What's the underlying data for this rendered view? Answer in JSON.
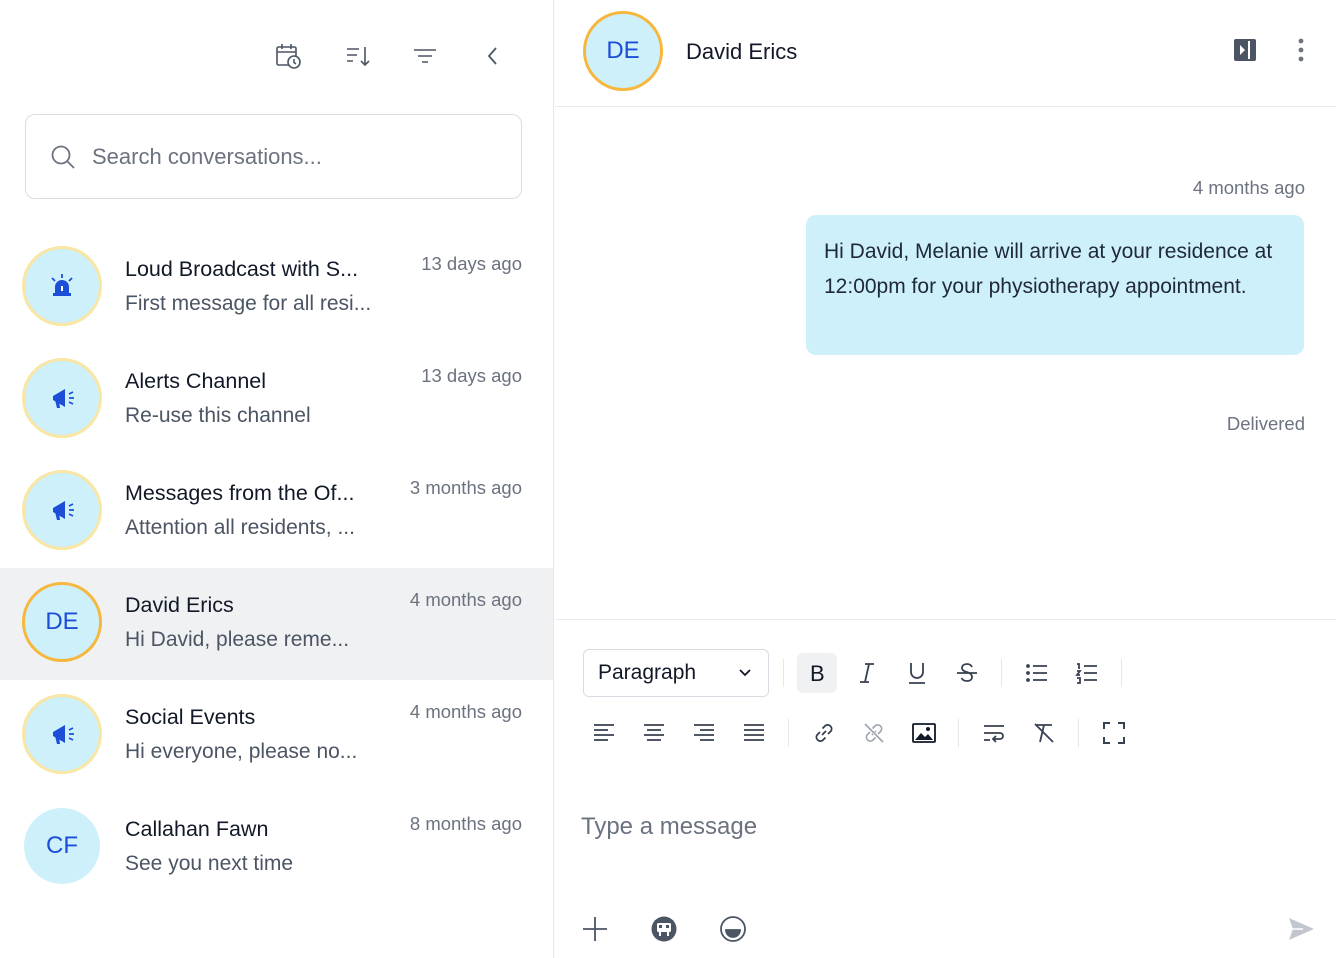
{
  "search": {
    "placeholder": "Search conversations..."
  },
  "conversations": [
    {
      "name": "Loud Broadcast with S...",
      "preview": "First message for all resi...",
      "time": "13 days ago",
      "avatar_icon": "siren-icon",
      "active": false
    },
    {
      "name": "Alerts Channel",
      "preview": "Re-use this channel",
      "time": "13 days ago",
      "avatar_icon": "megaphone-icon",
      "active": false
    },
    {
      "name": "Messages from the Of...",
      "preview": "Attention all residents, ...",
      "time": "3 months ago",
      "avatar_icon": "megaphone-icon",
      "active": false
    },
    {
      "name": "David Erics",
      "preview": "Hi David, please reme...",
      "time": "4 months ago",
      "initials": "DE",
      "active": true
    },
    {
      "name": "Social Events",
      "preview": "Hi everyone, please no...",
      "time": "4 months ago",
      "avatar_icon": "megaphone-icon",
      "active": false
    },
    {
      "name": "Callahan Fawn",
      "preview": "See you next time",
      "time": "8 months ago",
      "initials": "CF",
      "active": false
    }
  ],
  "chat": {
    "initials": "DE",
    "name": "David Erics",
    "message": {
      "time": "4 months ago",
      "text": "Hi David, Melanie will arrive at your residence at 12:00pm for your physiotherapy appointment.",
      "status": "Delivered"
    }
  },
  "composer": {
    "format": "Paragraph",
    "placeholder": "Type a message"
  },
  "colors": {
    "avatar_bg": "#cdf0fb",
    "avatar_ring_active": "#f6b73c",
    "avatar_ring_light": "#f9e6a3",
    "initials_text": "#1d4ed8",
    "bubble_bg": "#cdf0fb",
    "active_row_bg": "#f0f1f3"
  }
}
